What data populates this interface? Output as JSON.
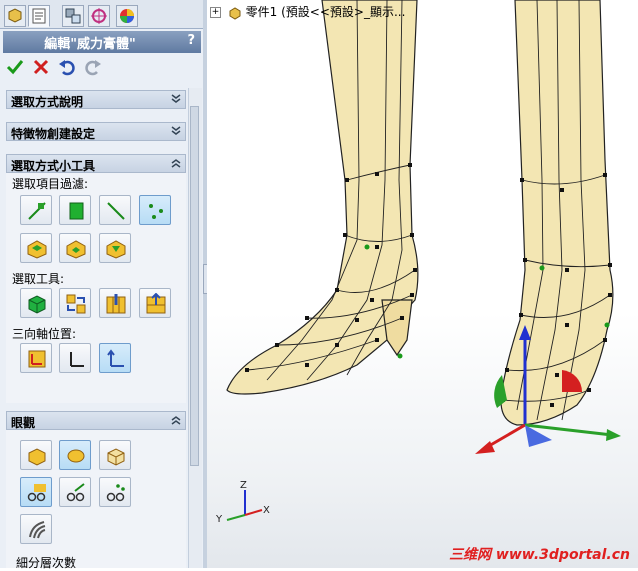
{
  "tabs": [
    "feature-manager",
    "property-manager",
    "configuration-manager",
    "dimxpert-manager",
    "display-manager"
  ],
  "property_manager": {
    "title": "編輯\"威力膏體\"",
    "help": "?"
  },
  "sections": {
    "selection_help": "選取方式說明",
    "feature_settings": "特徵物創建設定",
    "selection_tools_panel": "選取方式小工具",
    "filter_label": "選取項目過濾:",
    "tools_label": "選取工具:",
    "triad_label": "三向軸位置:",
    "display": "眼觀",
    "subdivision_label": "細分層次數"
  },
  "tree": {
    "expand": "+",
    "part_text": "零件1 (預設<<預設>_顯示..."
  },
  "watermark": "三维网 www.3dportal.cn",
  "triad_labels": {
    "z": "Z",
    "x": "X",
    "y": "Y"
  },
  "colors": {
    "accent": "#5f7aa1",
    "model": "#f3e6b3",
    "x_axis": "#d42020",
    "y_axis": "#2aa02a",
    "z_axis": "#2030d0"
  }
}
